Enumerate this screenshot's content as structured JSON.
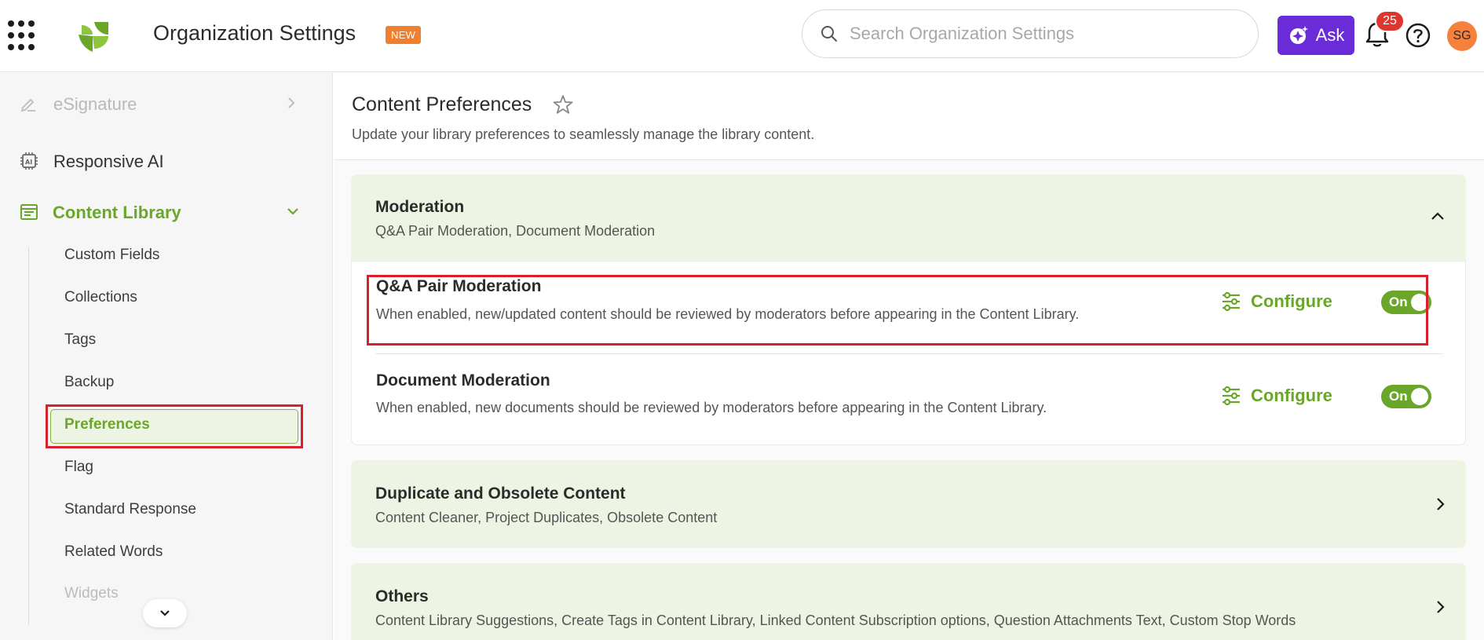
{
  "header": {
    "title": "Organization Settings",
    "new_badge": "NEW",
    "search_placeholder": "Search Organization Settings",
    "ask_label": "Ask",
    "notification_count": "25",
    "avatar_initials": "SG",
    "brand_color": "#6aa62a",
    "ask_color": "#6a2bd8"
  },
  "sidebar": {
    "top_items": [
      {
        "label": "eSignature",
        "icon": "pen-signature-icon",
        "state": "disabled"
      },
      {
        "label": "Responsive AI",
        "icon": "ai-chip-icon"
      },
      {
        "label": "Content Library",
        "icon": "library-icon",
        "state": "expanded"
      }
    ],
    "sub_items": [
      {
        "label": "Custom Fields"
      },
      {
        "label": "Collections"
      },
      {
        "label": "Tags"
      },
      {
        "label": "Backup"
      },
      {
        "label": "Preferences",
        "active": true
      },
      {
        "label": "Flag"
      },
      {
        "label": "Standard Response"
      },
      {
        "label": "Related Words"
      },
      {
        "label": "Widgets"
      }
    ]
  },
  "main": {
    "title": "Content Preferences",
    "subtitle": "Update your library preferences to seamlessly manage the library content.",
    "sections": [
      {
        "title": "Moderation",
        "summary": "Q&A Pair Moderation, Document Moderation",
        "expanded": true,
        "rows": [
          {
            "title": "Q&A Pair Moderation",
            "description": "When enabled, new/updated content should be reviewed by moderators before appearing in the Content Library.",
            "configure_label": "Configure",
            "toggle_label": "On"
          },
          {
            "title": "Document Moderation",
            "description": "When enabled, new documents should be reviewed by moderators before appearing in the Content Library.",
            "configure_label": "Configure",
            "toggle_label": "On"
          }
        ]
      },
      {
        "title": "Duplicate and Obsolete Content",
        "summary": "Content Cleaner, Project Duplicates, Obsolete Content",
        "expanded": false
      },
      {
        "title": "Others",
        "summary": "Content Library Suggestions, Create Tags in Content Library, Linked Content Subscription options, Question Attachments Text, Custom Stop Words",
        "expanded": false
      }
    ]
  }
}
